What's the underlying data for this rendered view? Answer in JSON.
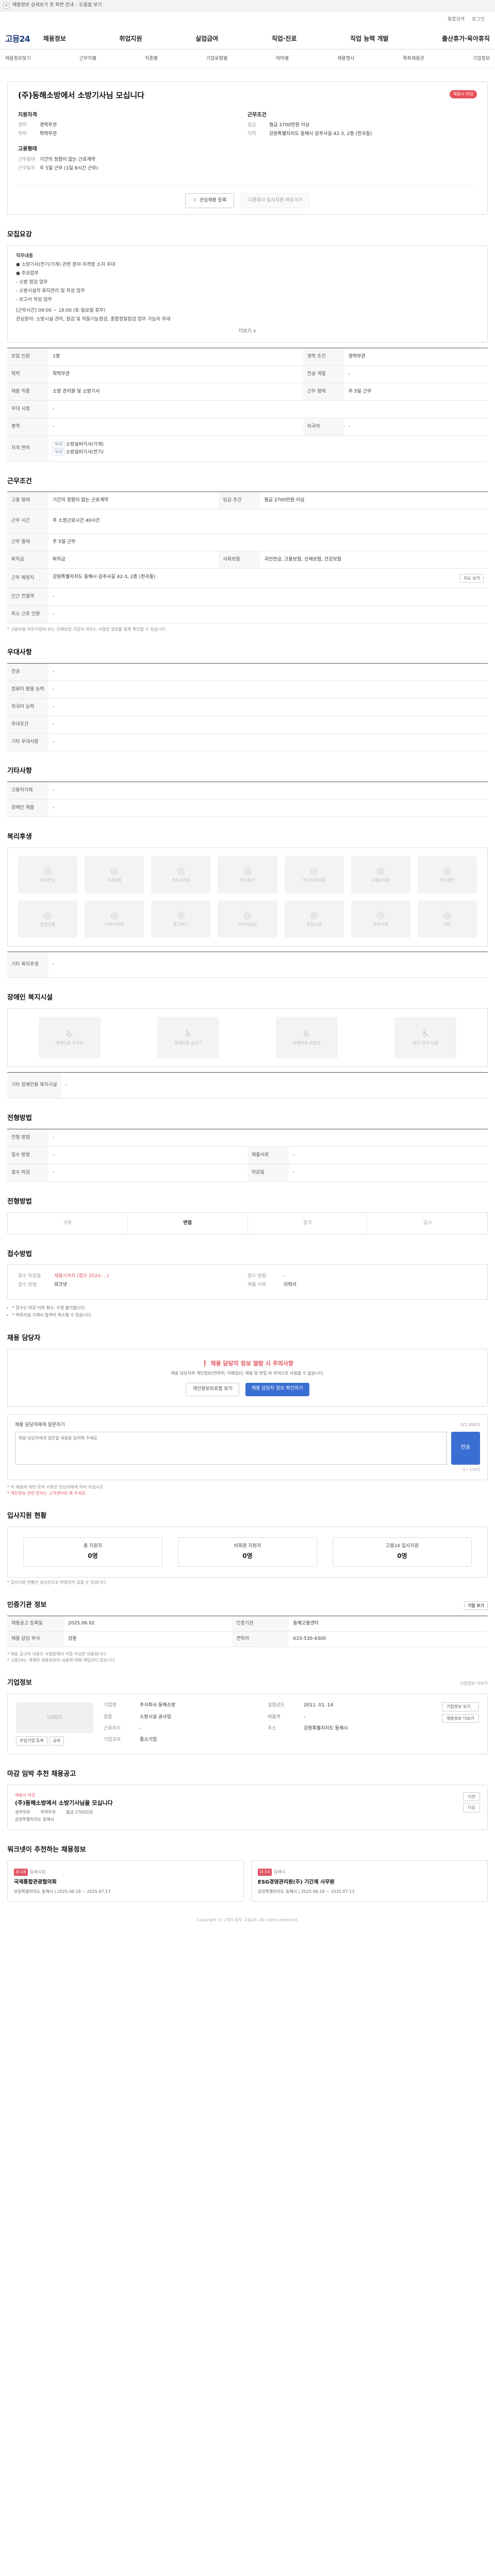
{
  "banner": {
    "close": "×",
    "text": "채용정보 상세보기 첫 화면 안내 – 도움말 보기"
  },
  "util": {
    "search": "통합검색",
    "login": "로그인"
  },
  "gnb": {
    "logo": "고용24",
    "menus": [
      "채용정보",
      "취업지원",
      "실업급여",
      "직업·진로",
      "직업 능력 개발",
      "출산휴가·육아휴직"
    ]
  },
  "lnb": [
    "채용정보찾기",
    "근무지별",
    "직종별",
    "기업유형별",
    "테마별",
    "채용행사",
    "특화채용관",
    "기업정보"
  ],
  "header": {
    "title": "(주)동해소방에서 소방기사님 모십니다",
    "badge": "채용시 마감",
    "qual": {
      "h": "지원자격",
      "rows": [
        [
          "경력",
          "경력무관"
        ],
        [
          "학력",
          "학력무관"
        ]
      ]
    },
    "cond": {
      "h": "근무조건",
      "rows": [
        [
          "임금",
          "월급 2700만원 이상"
        ],
        [
          "지역",
          "강원특별자치도 동해시 감추사길 42-3, 2층 (천곡동)"
        ]
      ]
    },
    "work": {
      "h": "고용형태",
      "rows": [
        [
          "근무형태",
          "기간의 정함이 없는 근로계약"
        ],
        [
          "근무일자",
          "주 5일 근무 (1일 8시간 근무)"
        ]
      ]
    },
    "btn_scrap": "관심채용 등록",
    "btn_apply": "다른회사 입사지원 바로가기"
  },
  "recruit": {
    "h": "모집요강",
    "body": [
      "직무내용",
      "● 소방기사(전기/기계) 관련 분야 자격증 소지 우대",
      "● 주요업무",
      " - 소방 점검 업무",
      " - 소방시설의 유지관리 및 작성 업무",
      " - 보고서 작성 업무",
      "[근무시간] 09:00 ~ 18:00 (토·일요일 휴무)",
      "관심분야: 소방시설 관리, 점검 및 작동기능점검, 종합정밀점검 업무 가능자 우대"
    ],
    "more": "더보기 ∨",
    "table": [
      [
        "모집 인원",
        "1명",
        "경력 조건",
        "경력무관"
      ],
      [
        "학력",
        "학력무관",
        "전공 계열",
        "-"
      ],
      [
        "채용 직종",
        "소방 관리원 및 소방기사",
        "근무 형태",
        "주 5일 근무"
      ],
      [
        "우대 사항",
        "-",
        "",
        ""
      ],
      [
        "병역",
        "-",
        "외국어",
        "-"
      ]
    ],
    "cert": {
      "k": "자격 면허",
      "items": [
        "소방설비기사(기계)",
        "소방설비기사(전기)"
      ]
    }
  },
  "condition": {
    "h": "근무조건",
    "table": [
      [
        "고용 형태",
        "기간의 정함이 없는 근로계약",
        "임금 조건",
        "월급 2700만원 이상"
      ],
      [
        "근무 시간",
        "주 소정근로시간 40시간",
        "",
        ""
      ],
      [
        "근무 형태",
        "주 5일 근무",
        "",
        ""
      ],
      [
        "퇴직금",
        "퇴직금",
        "사회보험",
        "국민연금, 고용보험, 산재보험, 건강보험"
      ],
      [
        "근무 예정지",
        "강원특별자치도 동해시 감추사길 42-3, 2층 (천곡동)",
        "",
        ""
      ],
      [
        "인근 전철역",
        "-",
        "",
        ""
      ],
      [
        "최소 근로 인원",
        "-",
        "",
        ""
      ]
    ],
    "map_btn": "지도 보기",
    "foot": "* 고용보험 의무가입자 또는 산재보험 가입자 여부는 사업장 정보를 통해 확인할 수 있습니다."
  },
  "prefer": {
    "h": "우대사항",
    "table": [
      [
        "전공",
        "-"
      ],
      [
        "컴퓨터 활용 능력",
        "-"
      ],
      [
        "외국어 능력",
        "-"
      ],
      [
        "우대조건",
        "-"
      ],
      [
        "기타 우대사항",
        "-"
      ]
    ]
  },
  "etc": {
    "h": "기타사항",
    "table": [
      [
        "고용허가제",
        "-"
      ],
      [
        "장애인 채용",
        "-"
      ]
    ]
  },
  "welfare": {
    "h": "복리후생",
    "items": [
      "퇴직연금",
      "4대보험",
      "경조금지원",
      "연차휴가",
      "야근식대지원",
      "교통비지원",
      "건강검진",
      "명절선물",
      "기숙사지원",
      "통근버스",
      "자녀학자금",
      "휴양시설",
      "주차지원",
      "기타"
    ],
    "note": "기타 복리후생"
  },
  "disabled": {
    "h": "장애인 복지시설",
    "items": [
      "장애인용 주차장",
      "장애인용 승강기",
      "장애인용 화장실",
      "점자 안내 시설"
    ],
    "note": "기타 장애인용 복지시설"
  },
  "apply_info": {
    "h": "전형방법",
    "table": [
      [
        "전형 방법",
        "-",
        "",
        ""
      ],
      [
        "접수 방법",
        "-",
        "제출서류",
        "-"
      ],
      [
        "접수 마감",
        "-",
        "마감일",
        "-"
      ]
    ]
  },
  "process": {
    "h": "전형방법",
    "steps": [
      "서류",
      "면접",
      "합격",
      "입사"
    ]
  },
  "receipt": {
    "h": "접수방법",
    "l": [
      [
        "접수 마감일",
        "채용시까지 (접수 2024-…)"
      ],
      [
        "접수 방법",
        "워크넷"
      ]
    ],
    "r": [
      [
        "접수 방법",
        "-"
      ],
      [
        "제출 서류",
        "이력서"
      ]
    ],
    "notes": [
      "* 접수는 마감 이후 취소, 수정 불가합니다.",
      "* 허위사실 기재시 합격이 취소될 수 있습니다."
    ]
  },
  "contact": {
    "h": "채용 담당자",
    "alert": "채용 담당자 정보 열람 시 주의사항",
    "desc": "채용 담당자의 개인정보(연락처, 이메일)는 채용 및 면접 외 목적으로 사용할 수 없습니다.",
    "btn1": "개인정보보호법 보기",
    "btn2": "채용 담당자 정보 확인하기",
    "inq_h": "채용 담당자에게 질문하기",
    "inq_small": "0/1,000자",
    "placeholder": "채용 담당자에게 질문할 내용을 입력해 주세요.",
    "inq_btn": "전송",
    "counter": "0 / 1000",
    "note1": "* 이 채용에 대한 문의 사항은 담당자에게 하여 주십시오.",
    "note2": "* 개인정보 관련 문의는 고객센터로 해 주세요."
  },
  "status": {
    "h": "입사지원 현황",
    "items": [
      [
        "총 지원자",
        "0명"
      ],
      [
        "비회원 지원자",
        "0명"
      ],
      [
        "고용24 입사지원",
        "0명"
      ]
    ],
    "note": "* 입사지원 현황은 실시간으로 반영되지 않을 수 있습니다."
  },
  "regist": {
    "h": "인증기관 정보",
    "rows": [
      [
        "채용공고 등록일",
        "2025.06.02",
        "인증기관",
        "동해고용센터"
      ],
      [
        "채용 담당 부서",
        "강원",
        "연락처",
        "033-530-4300"
      ]
    ],
    "btn": "기업 보기",
    "notes": [
      "* 채용 공고의 내용은 사업장에서 직접 작성한 내용입니다.",
      "* 고용24는 게재된 채용정보의 내용에 대해 책임지지 않습니다."
    ]
  },
  "company": {
    "h": "기업정보",
    "more": "기업정보 더보기",
    "logo": "LOGO",
    "rows": [
      [
        "기업명",
        "주식회사 동해소방",
        "설립년도",
        "2011. 01. 14"
      ],
      [
        "업종",
        "소방시설 공사업",
        "매출액",
        "-"
      ],
      [
        "근로자수",
        "-",
        "주소",
        "강원특별자치도 동해시"
      ],
      [
        "기업규모",
        "중소기업",
        "",
        ""
      ]
    ],
    "btns": [
      "기업정보 보기",
      "채용정보 더보기"
    ],
    "mini": [
      "관심기업 등록",
      "공유"
    ]
  },
  "closing": {
    "h": "마감 임박 추천 채용공고",
    "tag": "채용시 마감",
    "name": "(주)동해소방에서 소방기사님을 모십니다",
    "meta": [
      "경력무관",
      "학력무관",
      "월급 2700만원"
    ],
    "loc": "강원특별자치도 동해시",
    "slides": [
      "이전",
      "다음"
    ]
  },
  "recommend": {
    "h": "워크넷이 추천하는 채용정보",
    "cards": [
      {
        "tag": "D-18",
        "org": "동해시청",
        "name": "국제통합관광협의회",
        "meta": "강원특별자치도 동해시 | 2025.06.18 ~ 2025.07.17"
      },
      {
        "tag": "D-13",
        "org": "동해시",
        "name": "ESG경영관리원(주) 기간제 사무원",
        "meta": "강원특별자치도 동해시 | 2025.06.18 ~ 2025.07.13"
      }
    ]
  },
  "footer": "Copyright © 고용노동부 고용24. All rights reserved."
}
